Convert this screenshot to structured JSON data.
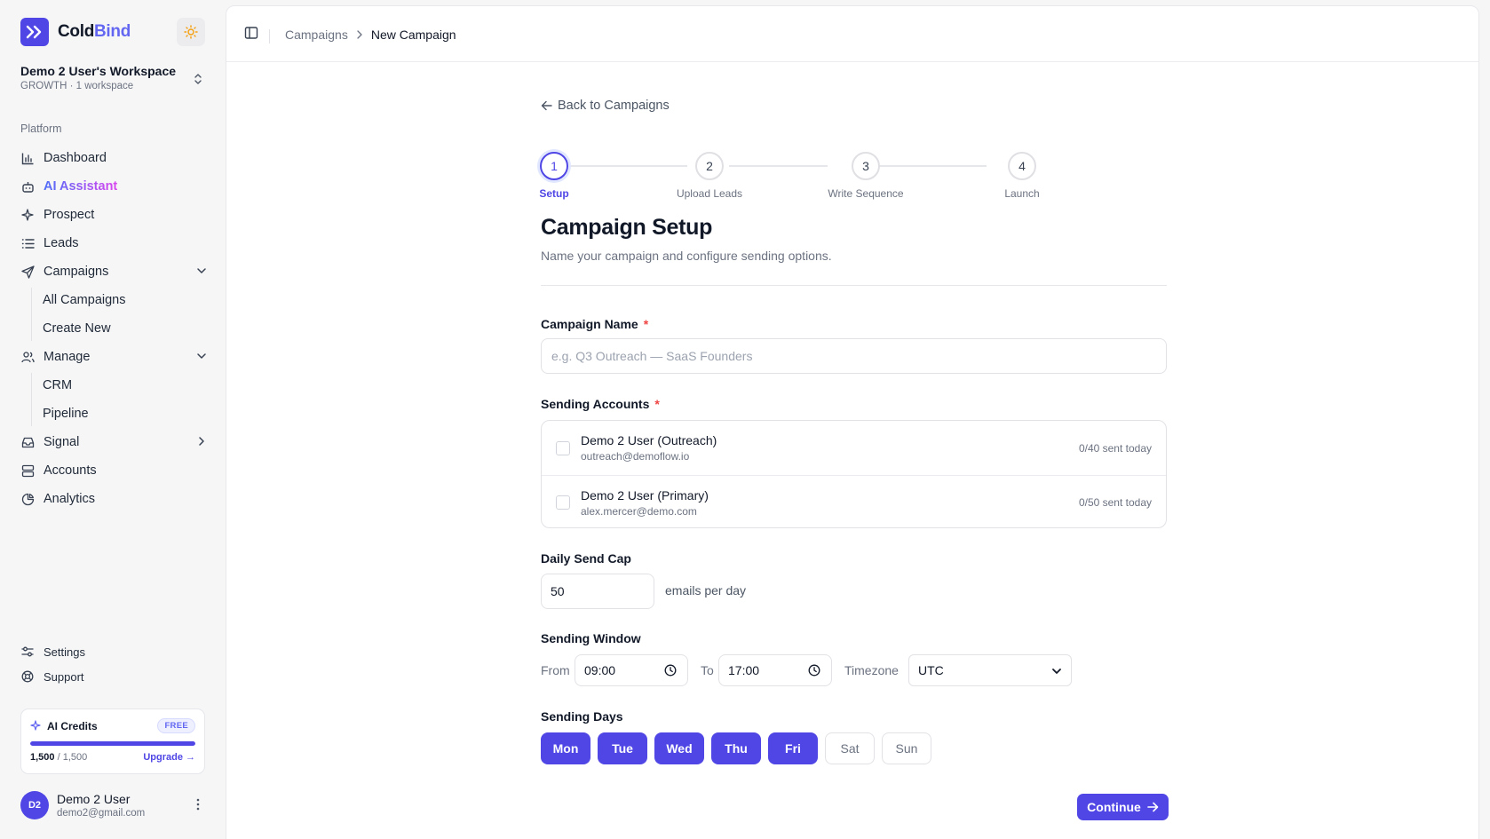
{
  "brand": {
    "part1": "Cold",
    "part2": "Bind"
  },
  "workspace": {
    "name": "Demo 2 User's Workspace",
    "plan": "GROWTH · 1 workspace"
  },
  "sidebar": {
    "section_label": "Platform",
    "items": {
      "dashboard": "Dashboard",
      "ai_assistant": "AI Assistant",
      "prospect": "Prospect",
      "leads": "Leads",
      "campaigns": "Campaigns",
      "all_campaigns": "All Campaigns",
      "create_new": "Create New",
      "manage": "Manage",
      "crm": "CRM",
      "pipeline": "Pipeline",
      "signal": "Signal",
      "accounts": "Accounts",
      "analytics": "Analytics"
    },
    "bottom": {
      "settings": "Settings",
      "support": "Support"
    }
  },
  "credits": {
    "title": "AI Credits",
    "badge": "FREE",
    "used": "1,500",
    "total": " / 1,500",
    "fraction_remaining": 1.0,
    "upgrade": "Upgrade →"
  },
  "user": {
    "initials": "D2",
    "name": "Demo 2 User",
    "email": "demo2@gmail.com"
  },
  "breadcrumb": {
    "parent": "Campaigns",
    "current": "New Campaign"
  },
  "back_link": "Back to Campaigns",
  "stepper": {
    "steps": [
      {
        "num": "1",
        "label": "Setup"
      },
      {
        "num": "2",
        "label": "Upload Leads"
      },
      {
        "num": "3",
        "label": "Write Sequence"
      },
      {
        "num": "4",
        "label": "Launch"
      }
    ]
  },
  "page": {
    "title": "Campaign Setup",
    "subtitle": "Name your campaign and configure sending options."
  },
  "form": {
    "name_label": "Campaign Name",
    "required_mark": "*",
    "name_placeholder": "e.g. Q3 Outreach — SaaS Founders",
    "accounts_label": "Sending Accounts",
    "accounts": [
      {
        "name": "Demo 2 User (Outreach)",
        "email": "outreach@demoflow.io",
        "sent": "0/40 sent today"
      },
      {
        "name": "Demo 2 User (Primary)",
        "email": "alex.mercer@demo.com",
        "sent": "0/50 sent today"
      }
    ],
    "cap_label": "Daily Send Cap",
    "cap_value": "50",
    "cap_suffix": "emails per day",
    "window_label": "Sending Window",
    "from_label": "From",
    "from_value": "09:00",
    "to_label": "To",
    "to_value": "17:00",
    "tz_label": "Timezone",
    "tz_value": "UTC",
    "days_label": "Sending Days",
    "days": [
      "Mon",
      "Tue",
      "Wed",
      "Thu",
      "Fri",
      "Sat",
      "Sun"
    ],
    "continue": "Continue"
  },
  "colors": {
    "accent": "#4f46e5",
    "required": "#ef4444"
  }
}
